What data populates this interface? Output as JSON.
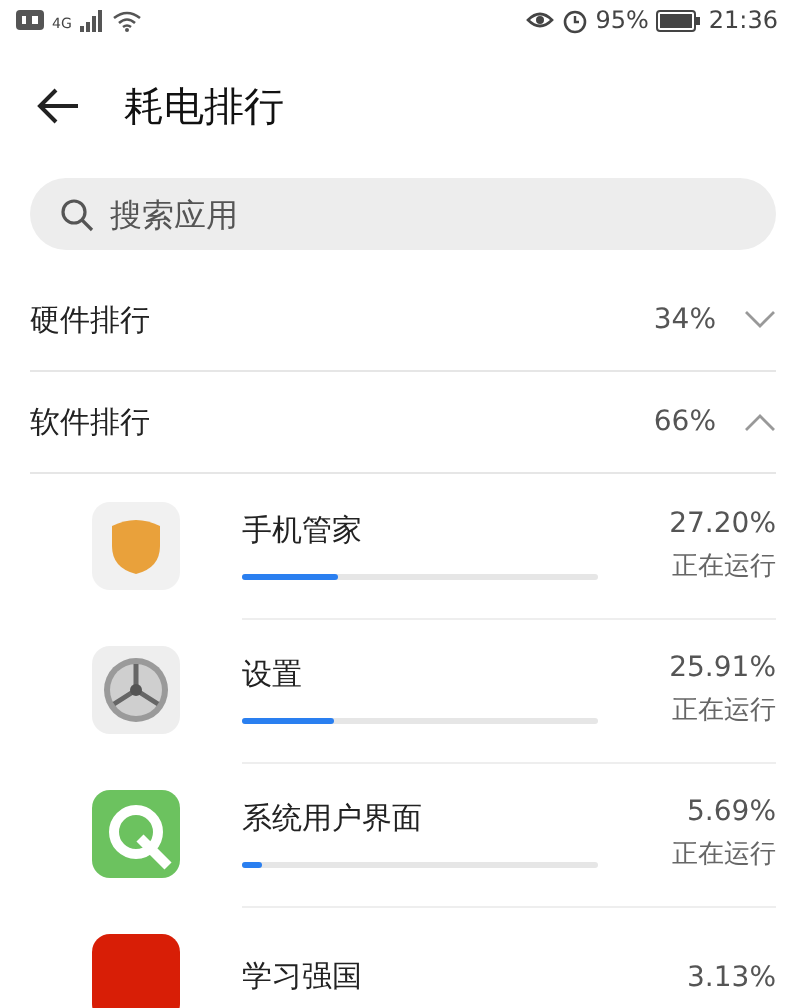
{
  "status_bar": {
    "network": "4G",
    "battery": "95%",
    "time": "21:36"
  },
  "header": {
    "title": "耗电排行"
  },
  "search": {
    "placeholder": "搜索应用"
  },
  "sections": [
    {
      "label": "硬件排行",
      "percent": "34%",
      "expanded": false
    },
    {
      "label": "软件排行",
      "percent": "66%",
      "expanded": true
    }
  ],
  "apps": [
    {
      "name": "手机管家",
      "percent": "27.20%",
      "status": "正在运行",
      "level": 0.272,
      "kind": "shield"
    },
    {
      "name": "设置",
      "percent": "25.91%",
      "status": "正在运行",
      "level": 0.259,
      "kind": "gear"
    },
    {
      "name": "系统用户界面",
      "percent": "5.69%",
      "status": "正在运行",
      "level": 0.057,
      "kind": "q"
    },
    {
      "name": "学习强国",
      "percent": "3.13%",
      "kind": "red"
    }
  ]
}
